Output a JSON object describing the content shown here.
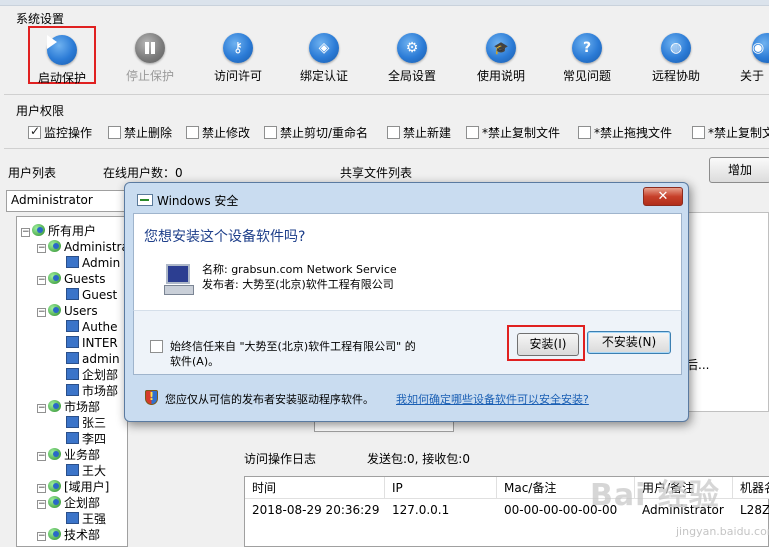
{
  "toolbar": {
    "section_label": "系统设置",
    "buttons": [
      {
        "label": "启动保护",
        "glyph": "play"
      },
      {
        "label": "停止保护",
        "glyph": "pause"
      },
      {
        "label": "访问许可",
        "glyph": "⚷"
      },
      {
        "label": "绑定认证",
        "glyph": "◈"
      },
      {
        "label": "全局设置",
        "glyph": "⚙"
      },
      {
        "label": "使用说明",
        "glyph": "🎓"
      },
      {
        "label": "常见问题",
        "glyph": "?"
      },
      {
        "label": "远程协助",
        "glyph": "◍"
      },
      {
        "label": "关于",
        "glyph": "◉"
      }
    ]
  },
  "permissions": {
    "section_label": "用户权限",
    "items": [
      {
        "label": "监控操作",
        "checked": true
      },
      {
        "label": "禁止删除",
        "checked": false
      },
      {
        "label": "禁止修改",
        "checked": false
      },
      {
        "label": "禁止剪切/重命名",
        "checked": false
      },
      {
        "label": "禁止新建",
        "checked": false
      },
      {
        "label": "*禁止复制文件",
        "checked": false
      },
      {
        "label": "*禁止拖拽文件",
        "checked": false
      },
      {
        "label": "*禁止复制文",
        "checked": false
      }
    ]
  },
  "users": {
    "list_label": "用户列表",
    "online_label": "在线用户数：0",
    "shared_label": "共享文件列表",
    "add_button": "增加",
    "selected_user": "Administrator",
    "tree": [
      {
        "label": "所有用户",
        "level": 0,
        "type": "globe"
      },
      {
        "label": "Administrat",
        "level": 1,
        "type": "globe"
      },
      {
        "label": "Admin",
        "level": 2,
        "type": "pc"
      },
      {
        "label": "Guests",
        "level": 1,
        "type": "globe"
      },
      {
        "label": "Guest",
        "level": 2,
        "type": "pc"
      },
      {
        "label": "Users",
        "level": 1,
        "type": "globe"
      },
      {
        "label": "Authe",
        "level": 2,
        "type": "pc"
      },
      {
        "label": "INTER",
        "level": 2,
        "type": "pc"
      },
      {
        "label": "admin",
        "level": 2,
        "type": "pc"
      },
      {
        "label": "企划部",
        "level": 2,
        "type": "pc"
      },
      {
        "label": "市场部",
        "level": 2,
        "type": "pc"
      },
      {
        "label": "市场部",
        "level": 1,
        "type": "globe"
      },
      {
        "label": "张三",
        "level": 2,
        "type": "pc"
      },
      {
        "label": "李四",
        "level": 2,
        "type": "pc"
      },
      {
        "label": "业务部",
        "level": 1,
        "type": "globe"
      },
      {
        "label": "王大",
        "level": 2,
        "type": "pc"
      },
      {
        "label": "[域用户]",
        "level": 1,
        "type": "globe"
      },
      {
        "label": "企划部",
        "level": 1,
        "type": "globe"
      },
      {
        "label": "王强",
        "level": 2,
        "type": "pc"
      },
      {
        "label": "技术部",
        "level": 1,
        "type": "globe"
      }
    ]
  },
  "log": {
    "title": "访问操作日志",
    "stats": "发送包:0, 接收包:0",
    "columns": [
      "时间",
      "IP",
      "Mac/备注",
      "用户/备注",
      "机器名"
    ],
    "rows": [
      [
        "2018-08-29 20:36:29",
        "127.0.0.1",
        "00-00-00-00-00-00",
        "Administrator",
        "L28Z"
      ]
    ],
    "partial_text": "后..."
  },
  "dialog": {
    "title": "Windows 安全",
    "close_glyph": "✕",
    "question": "您想安装这个设备软件吗?",
    "device_name": "名称: grabsun.com Network Service",
    "publisher": "发布者: 大势至(北京)软件工程有限公司",
    "trust_line1": "始终信任来自 \"大势至(北京)软件工程有限公司\" 的",
    "trust_line2": "软件(A)。",
    "install_button": "安装(I)",
    "noinstall_button": "不安装(N)",
    "footer_text": "您应仅从可信的发布者安装驱动程序软件。",
    "footer_link": "我如何确定哪些设备软件可以安全安装?"
  },
  "watermark": {
    "main": "Bai 经验",
    "sub": "jingyan.baidu.com"
  }
}
